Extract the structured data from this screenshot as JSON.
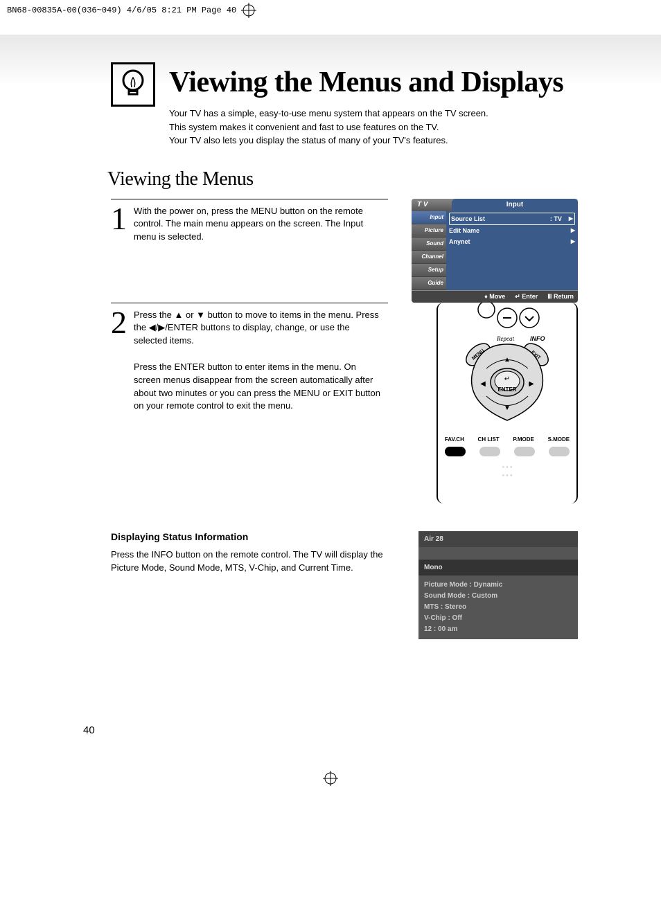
{
  "header_strip": "BN68-00835A-00(036~049)  4/6/05  8:21 PM  Page 40",
  "main_title": "Viewing the Menus and Displays",
  "intro_line1": "Your TV has a simple, easy-to-use menu system that appears on the TV screen.",
  "intro_line2": "This system makes it convenient and fast to use features on the TV.",
  "intro_line3": "Your TV also lets you display the status of many of your TV's features.",
  "section_title": "Viewing the Menus",
  "step1_num": "1",
  "step1_text": "With the power on, press the MENU button on the remote control. The main menu appears on the screen. The Input menu is selected.",
  "step2_num": "2",
  "step2_text_a": "Press the ▲ or ▼ button to move to items in the menu. Press the ◀/▶/ENTER buttons to display, change, or use the selected items.",
  "step2_text_b": "Press the ENTER button to enter items in the menu. On screen menus disappear from the screen automatically after about two minutes or you can press the MENU or EXIT button on your remote control to exit the menu.",
  "osd": {
    "tv_label": "T V",
    "title": "Input",
    "side": [
      "Input",
      "Picture",
      "Sound",
      "Channel",
      "Setup",
      "Guide"
    ],
    "rows": [
      {
        "label": "Source List",
        "val": ": TV"
      },
      {
        "label": "Edit Name",
        "val": ""
      },
      {
        "label": "Anynet",
        "val": ""
      }
    ],
    "footer_move": "Move",
    "footer_enter": "Enter",
    "footer_return": "Return"
  },
  "remote": {
    "enter": "ENTER",
    "menu": "MENU",
    "info": "INFO",
    "exit": "EXIT",
    "repeat": "Repeat",
    "labels": [
      "FAV.CH",
      "CH LIST",
      "P.MODE",
      "S.MODE"
    ]
  },
  "sub_heading": "Displaying Status Information",
  "status_text": "Press the INFO button on the remote control. The TV will display the Picture Mode, Sound Mode, MTS, V-Chip, and Current Time.",
  "info_box": {
    "header": "Air 28",
    "sub": "Mono",
    "lines": [
      "Picture Mode : Dynamic",
      "Sound Mode : Custom",
      "MTS : Stereo",
      "V-Chip : Off",
      "12 : 00 am"
    ]
  },
  "page_num": "40"
}
